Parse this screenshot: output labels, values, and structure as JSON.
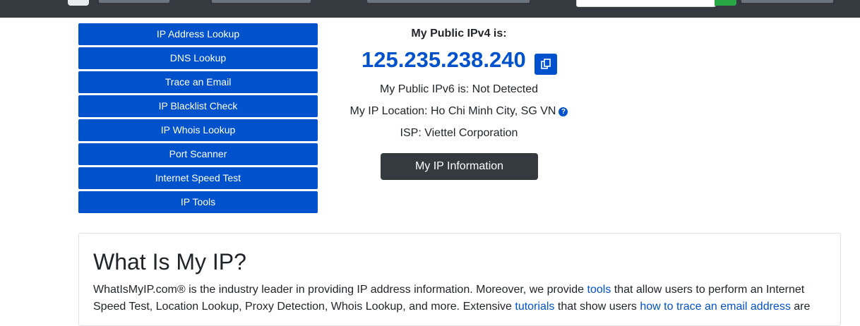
{
  "tools": [
    "IP Address Lookup",
    "DNS Lookup",
    "Trace an Email",
    "IP Blacklist Check",
    "IP Whois Lookup",
    "Port Scanner",
    "Internet Speed Test",
    "IP Tools"
  ],
  "ip": {
    "ipv4_heading": "My Public IPv4 is:",
    "ipv4_value": "125.235.238.240",
    "ipv6_line": "My Public IPv6 is: Not Detected",
    "location_line": "My IP Location: Ho Chi Minh City, SG VN",
    "isp_line": "ISP: Viettel Corporation",
    "info_button": "My IP Information",
    "help_glyph": "?"
  },
  "article": {
    "heading": "What Is My IP?",
    "p1_before": "WhatIsMyIP.com® is the industry leader in providing IP address information. Moreover, we provide ",
    "link_tools": "tools",
    "p1_mid": " that allow users to perform an Internet Speed Test, Location Lookup, Proxy Detection, Whois Lookup, and more. Extensive ",
    "link_tutorials": "tutorials",
    "p1_mid2": " that show users ",
    "link_trace": "how to trace an email address",
    "p1_after": " are"
  },
  "colors": {
    "accent": "#0052cc",
    "dark": "#343a40",
    "success": "#28a745"
  },
  "icons": {
    "copy": "copy-icon",
    "help": "question-circle-icon"
  }
}
